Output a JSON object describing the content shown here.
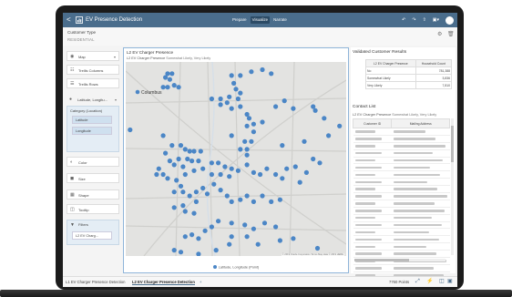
{
  "app": {
    "title": "EV Presence Detection",
    "back_label": "<",
    "tabs": [
      {
        "label": "Prepare",
        "active": false
      },
      {
        "label": "Visualize",
        "active": true
      },
      {
        "label": "Narrate",
        "active": false
      }
    ],
    "avatar_letter": "U"
  },
  "header": {
    "label": "Customer Type",
    "value": "RESIDENTIAL"
  },
  "grammar": {
    "viz_type": "Map",
    "items": [
      "Trellis Columns",
      "Trellis Rows"
    ],
    "layer_name": "Latitude, Longitu...",
    "category_label": "Category (Location)",
    "category_chips": [
      "Latitude",
      "Longitude"
    ],
    "items2": [
      "Color",
      "Size",
      "Shape",
      "Tooltip"
    ],
    "filters_label": "Filters",
    "filter_chip": "L2 EV Charg..."
  },
  "map": {
    "title": "L2 EV Charger Presence",
    "filter_field": "L2 EV Charger Presence",
    "filter_value": "Somewhat Likely, Very Likely",
    "city_label": "Columbus",
    "legend_label": "Latitude, Longitude (Point)",
    "attribution": "© 2019 Oracle Corporation   Terms   Map data © 2019 HERE",
    "point_color": "#4b86c6",
    "points": [
      [
        0.19,
        0.06
      ],
      [
        0.21,
        0.06
      ],
      [
        0.18,
        0.08
      ],
      [
        0.2,
        0.09
      ],
      [
        0.17,
        0.13
      ],
      [
        0.19,
        0.13
      ],
      [
        0.22,
        0.12
      ],
      [
        0.24,
        0.13
      ],
      [
        0.48,
        0.07
      ],
      [
        0.52,
        0.07
      ],
      [
        0.57,
        0.05
      ],
      [
        0.62,
        0.04
      ],
      [
        0.66,
        0.06
      ],
      [
        0.49,
        0.11
      ],
      [
        0.5,
        0.14
      ],
      [
        0.52,
        0.16
      ],
      [
        0.39,
        0.19
      ],
      [
        0.43,
        0.19
      ],
      [
        0.47,
        0.18
      ],
      [
        0.51,
        0.19
      ],
      [
        0.43,
        0.22
      ],
      [
        0.46,
        0.21
      ],
      [
        0.48,
        0.24
      ],
      [
        0.52,
        0.23
      ],
      [
        0.55,
        0.27
      ],
      [
        0.56,
        0.29
      ],
      [
        0.58,
        0.32
      ],
      [
        0.55,
        0.33
      ],
      [
        0.58,
        0.36
      ],
      [
        0.62,
        0.31
      ],
      [
        0.68,
        0.23
      ],
      [
        0.72,
        0.2
      ],
      [
        0.76,
        0.24
      ],
      [
        0.85,
        0.23
      ],
      [
        0.86,
        0.25
      ],
      [
        0.9,
        0.29
      ],
      [
        0.92,
        0.38
      ],
      [
        0.81,
        0.41
      ],
      [
        0.71,
        0.43
      ],
      [
        0.97,
        0.33
      ],
      [
        0.54,
        0.41
      ],
      [
        0.57,
        0.41
      ],
      [
        0.48,
        0.38
      ],
      [
        0.55,
        0.45
      ],
      [
        0.52,
        0.45
      ],
      [
        0.55,
        0.48
      ],
      [
        0.02,
        0.35
      ],
      [
        0.17,
        0.38
      ],
      [
        0.21,
        0.43
      ],
      [
        0.25,
        0.43
      ],
      [
        0.27,
        0.45
      ],
      [
        0.29,
        0.46
      ],
      [
        0.31,
        0.46
      ],
      [
        0.34,
        0.46
      ],
      [
        0.18,
        0.47
      ],
      [
        0.24,
        0.5
      ],
      [
        0.28,
        0.5
      ],
      [
        0.2,
        0.51
      ],
      [
        0.22,
        0.53
      ],
      [
        0.26,
        0.54
      ],
      [
        0.3,
        0.51
      ],
      [
        0.33,
        0.51
      ],
      [
        0.15,
        0.55
      ],
      [
        0.14,
        0.58
      ],
      [
        0.17,
        0.58
      ],
      [
        0.19,
        0.6
      ],
      [
        0.23,
        0.61
      ],
      [
        0.27,
        0.58
      ],
      [
        0.31,
        0.56
      ],
      [
        0.35,
        0.55
      ],
      [
        0.39,
        0.52
      ],
      [
        0.42,
        0.52
      ],
      [
        0.45,
        0.54
      ],
      [
        0.48,
        0.55
      ],
      [
        0.39,
        0.58
      ],
      [
        0.43,
        0.58
      ],
      [
        0.47,
        0.59
      ],
      [
        0.51,
        0.56
      ],
      [
        0.55,
        0.53
      ],
      [
        0.58,
        0.57
      ],
      [
        0.61,
        0.58
      ],
      [
        0.64,
        0.55
      ],
      [
        0.68,
        0.58
      ],
      [
        0.71,
        0.6
      ],
      [
        0.73,
        0.55
      ],
      [
        0.77,
        0.54
      ],
      [
        0.85,
        0.5
      ],
      [
        0.88,
        0.52
      ],
      [
        0.82,
        0.57
      ],
      [
        0.79,
        0.62
      ],
      [
        0.25,
        0.64
      ],
      [
        0.26,
        0.67
      ],
      [
        0.22,
        0.67
      ],
      [
        0.29,
        0.69
      ],
      [
        0.32,
        0.67
      ],
      [
        0.35,
        0.65
      ],
      [
        0.37,
        0.68
      ],
      [
        0.4,
        0.63
      ],
      [
        0.43,
        0.66
      ],
      [
        0.46,
        0.69
      ],
      [
        0.48,
        0.72
      ],
      [
        0.52,
        0.71
      ],
      [
        0.55,
        0.69
      ],
      [
        0.58,
        0.72
      ],
      [
        0.62,
        0.69
      ],
      [
        0.66,
        0.72
      ],
      [
        0.7,
        0.71
      ],
      [
        0.32,
        0.72
      ],
      [
        0.26,
        0.74
      ],
      [
        0.22,
        0.75
      ],
      [
        0.27,
        0.77
      ],
      [
        0.31,
        0.78
      ],
      [
        0.42,
        0.82
      ],
      [
        0.39,
        0.85
      ],
      [
        0.48,
        0.83
      ],
      [
        0.54,
        0.84
      ],
      [
        0.58,
        0.86
      ],
      [
        0.63,
        0.83
      ],
      [
        0.68,
        0.85
      ],
      [
        0.3,
        0.89
      ],
      [
        0.27,
        0.9
      ],
      [
        0.33,
        0.91
      ],
      [
        0.36,
        0.87
      ],
      [
        0.48,
        0.9
      ],
      [
        0.55,
        0.9
      ],
      [
        0.6,
        0.94
      ],
      [
        0.7,
        0.92
      ],
      [
        0.76,
        0.91
      ],
      [
        0.87,
        0.96
      ],
      [
        0.41,
        0.97
      ],
      [
        0.47,
        0.94
      ],
      [
        0.22,
        0.97
      ],
      [
        0.25,
        0.98
      ],
      [
        0.33,
        0.99
      ]
    ]
  },
  "validated": {
    "title": "Validated Customer Results",
    "columns": [
      "L2 EV Charger Presence",
      "Household Count"
    ],
    "rows": [
      {
        "label": "No",
        "value": "781,388"
      },
      {
        "label": "Somewhat Likely",
        "value": "3,836"
      },
      {
        "label": "Very Likely",
        "value": "7,810"
      }
    ]
  },
  "contact": {
    "title": "Contact List",
    "filter_field": "L2 EV Charger Presence",
    "filter_value": "Somewhat Likely, Very Likely",
    "columns": [
      "Customer ID",
      "Mailing Address"
    ],
    "row_count": 21
  },
  "footer": {
    "tabs": [
      "L1 EV Charger Presence Detection",
      "L2 EV Charger Presence Detection"
    ],
    "add_label": "+",
    "points_label": "7760 Points"
  }
}
